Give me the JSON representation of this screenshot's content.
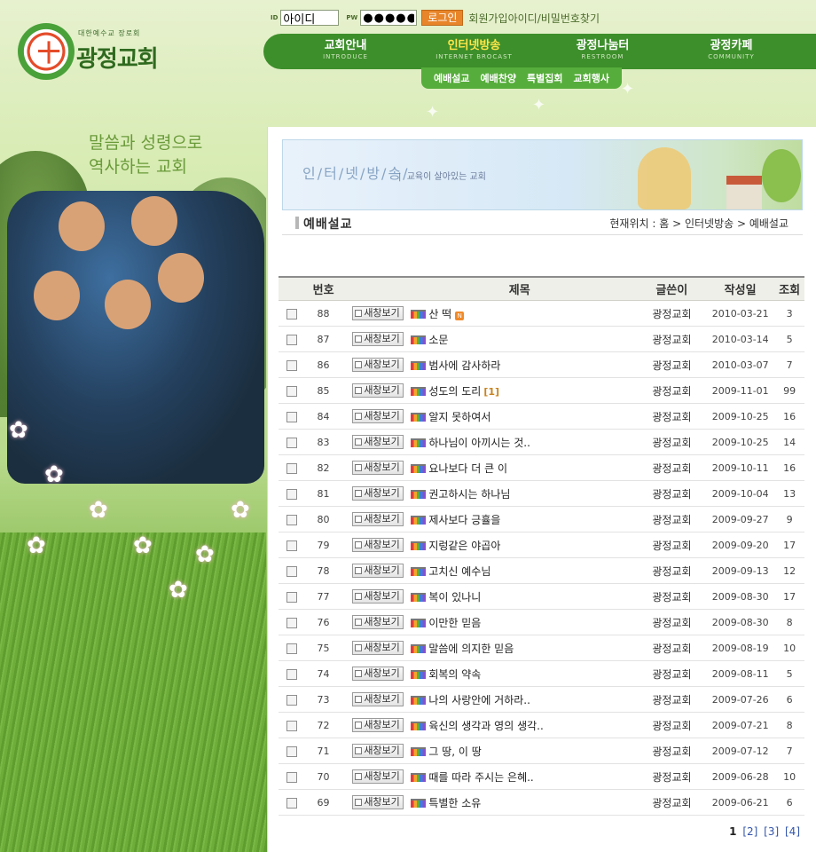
{
  "brand": {
    "sub": "대한예수교 장로회",
    "name": "광정교회",
    "mark": "十"
  },
  "slogan": {
    "line1": "말씀과 성령으로",
    "line2": "역사하는 교회"
  },
  "login": {
    "id_label": "ID",
    "id_value": "아이디",
    "pw_label": "PW",
    "pw_value": "●●●●●",
    "login_button": "로그인",
    "join": "회원가입",
    "find": "아이디/비밀번호찾기"
  },
  "nav": [
    {
      "ko": "교회안내",
      "en": "INTRODUCE"
    },
    {
      "ko": "인터넷방송",
      "en": "INTERNET BROCAST"
    },
    {
      "ko": "광정나눔터",
      "en": "RESTROOM"
    },
    {
      "ko": "광정카페",
      "en": "COMMUNITY"
    }
  ],
  "subnav": [
    "예배설교",
    "예배찬양",
    "특별집회",
    "교회행사"
  ],
  "banner": {
    "title": "인/터/넷/방/송/",
    "sep": "|",
    "tagline": "교육이 살아있는 교회"
  },
  "page": {
    "title": "예배설교",
    "location": "현재위치 : 홈 > 인터넷방송 > 예배설교"
  },
  "table": {
    "headers": {
      "num": "번호",
      "title": "제목",
      "writer": "글쓴이",
      "date": "작성일",
      "hits": "조회"
    },
    "newwin_label": "새창보기",
    "rows": [
      {
        "num": "88",
        "title": "산 떡",
        "comment": "",
        "new": true,
        "writer": "광정교회",
        "date": "2010-03-21",
        "hits": "3"
      },
      {
        "num": "87",
        "title": "소문",
        "comment": "",
        "new": false,
        "writer": "광정교회",
        "date": "2010-03-14",
        "hits": "5"
      },
      {
        "num": "86",
        "title": "범사에 감사하라",
        "comment": "",
        "new": false,
        "writer": "광정교회",
        "date": "2010-03-07",
        "hits": "7"
      },
      {
        "num": "85",
        "title": "성도의 도리",
        "comment": "[1]",
        "new": false,
        "writer": "광정교회",
        "date": "2009-11-01",
        "hits": "99"
      },
      {
        "num": "84",
        "title": "알지 못하여서",
        "comment": "",
        "new": false,
        "writer": "광정교회",
        "date": "2009-10-25",
        "hits": "16"
      },
      {
        "num": "83",
        "title": "하나님이 아끼시는 것..",
        "comment": "",
        "new": false,
        "writer": "광정교회",
        "date": "2009-10-25",
        "hits": "14"
      },
      {
        "num": "82",
        "title": "요나보다 더 큰 이",
        "comment": "",
        "new": false,
        "writer": "광정교회",
        "date": "2009-10-11",
        "hits": "16"
      },
      {
        "num": "81",
        "title": "권고하시는 하나님",
        "comment": "",
        "new": false,
        "writer": "광정교회",
        "date": "2009-10-04",
        "hits": "13"
      },
      {
        "num": "80",
        "title": "제사보다 긍휼을",
        "comment": "",
        "new": false,
        "writer": "광정교회",
        "date": "2009-09-27",
        "hits": "9"
      },
      {
        "num": "79",
        "title": "지렁같은 야곱아",
        "comment": "",
        "new": false,
        "writer": "광정교회",
        "date": "2009-09-20",
        "hits": "17"
      },
      {
        "num": "78",
        "title": "고치신 예수님",
        "comment": "",
        "new": false,
        "writer": "광정교회",
        "date": "2009-09-13",
        "hits": "12"
      },
      {
        "num": "77",
        "title": "복이 있나니",
        "comment": "",
        "new": false,
        "writer": "광정교회",
        "date": "2009-08-30",
        "hits": "17"
      },
      {
        "num": "76",
        "title": "이만한 믿음",
        "comment": "",
        "new": false,
        "writer": "광정교회",
        "date": "2009-08-30",
        "hits": "8"
      },
      {
        "num": "75",
        "title": "말씀에 의지한 믿음",
        "comment": "",
        "new": false,
        "writer": "광정교회",
        "date": "2009-08-19",
        "hits": "10"
      },
      {
        "num": "74",
        "title": "회복의 약속",
        "comment": "",
        "new": false,
        "writer": "광정교회",
        "date": "2009-08-11",
        "hits": "5"
      },
      {
        "num": "73",
        "title": "나의 사랑안에 거하라..",
        "comment": "",
        "new": false,
        "writer": "광정교회",
        "date": "2009-07-26",
        "hits": "6"
      },
      {
        "num": "72",
        "title": "육신의 생각과 영의 생각..",
        "comment": "",
        "new": false,
        "writer": "광정교회",
        "date": "2009-07-21",
        "hits": "8"
      },
      {
        "num": "71",
        "title": "그 땅, 이 땅",
        "comment": "",
        "new": false,
        "writer": "광정교회",
        "date": "2009-07-12",
        "hits": "7"
      },
      {
        "num": "70",
        "title": "때를 따라 주시는 은혜..",
        "comment": "",
        "new": false,
        "writer": "광정교회",
        "date": "2009-06-28",
        "hits": "10"
      },
      {
        "num": "69",
        "title": "특별한 소유",
        "comment": "",
        "new": false,
        "writer": "광정교회",
        "date": "2009-06-21",
        "hits": "6"
      }
    ]
  },
  "pagination": {
    "current": "1",
    "pages": [
      "[2]",
      "[3]",
      "[4]"
    ]
  },
  "colors": {
    "nav_bg": "#3d8f2b",
    "nav_active": "#ffe64a",
    "subnav_bg": "#56ad3b",
    "login_button": "#e8852a"
  }
}
